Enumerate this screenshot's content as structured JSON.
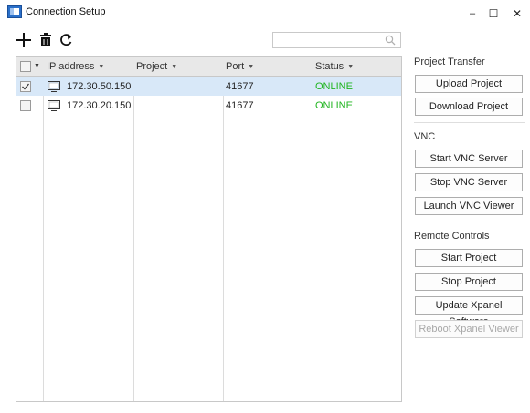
{
  "window": {
    "title": "Connection Setup",
    "minimize": "–",
    "maximize": "☐",
    "close": "✕"
  },
  "toolbar": {
    "add_icon": "plus-icon",
    "delete_icon": "trash-icon",
    "refresh_icon": "refresh-icon",
    "search_placeholder": ""
  },
  "table": {
    "columns": [
      "IP address",
      "Project",
      "Port",
      "Status"
    ],
    "rows": [
      {
        "ip": "172.30.50.150",
        "project": "",
        "port": "41677",
        "status": "ONLINE",
        "checked": true,
        "selected": true
      },
      {
        "ip": "172.30.20.150",
        "project": "",
        "port": "41677",
        "status": "ONLINE",
        "checked": false,
        "selected": false
      }
    ]
  },
  "panel": {
    "project_transfer": {
      "label": "Project Transfer",
      "upload": "Upload Project",
      "download": "Download Project"
    },
    "vnc": {
      "label": "VNC",
      "start": "Start VNC Server",
      "stop": "Stop VNC Server",
      "launch": "Launch VNC Viewer"
    },
    "remote": {
      "label": "Remote Controls",
      "start": "Start Project",
      "stop": "Stop Project",
      "update": "Update Xpanel Software",
      "reboot": "Reboot Xpanel Viewer"
    }
  },
  "colors": {
    "online": "#21b521",
    "selected_row": "#d8e8f8",
    "header_bg": "#e8e8e8"
  }
}
